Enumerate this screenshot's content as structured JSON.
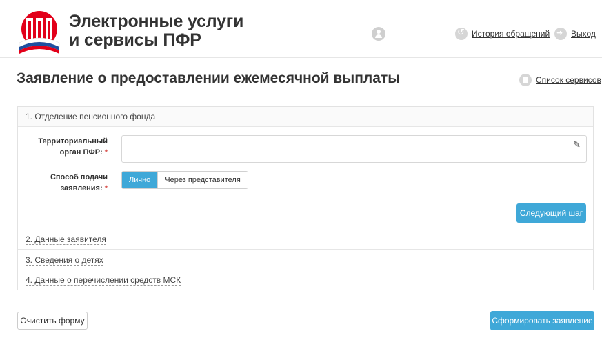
{
  "header": {
    "brand_line1": "Электронные услуги",
    "brand_line2": "и сервисы ПФР",
    "logo_icon": "pfr-logo-icon",
    "user_icon": "user-icon",
    "history_link": "История обращений",
    "history_icon": "history-icon",
    "exit_link": "Выход",
    "exit_icon": "exit-icon"
  },
  "page": {
    "title": "Заявление о предоставлении ежемесячной выплаты",
    "services_link": "Список сервисов",
    "services_icon": "list-icon"
  },
  "sections": [
    {
      "label": "1. Отделение пенсионного фонда"
    },
    {
      "label": "2. Данные заявителя"
    },
    {
      "label": "3. Сведения о детях"
    },
    {
      "label": "4. Данные о перечислении средств МСК"
    }
  ],
  "form": {
    "org_label_line1": "Территориальный",
    "org_label_line2": "орган ПФР:",
    "org_value": "",
    "method_label_line1": "Способ подачи",
    "method_label_line2": "заявления:",
    "method_options": [
      "Лично",
      "Через представителя"
    ],
    "method_selected": "Лично",
    "required_mark": "*",
    "next_button": "Следующий шаг"
  },
  "footer": {
    "clear_button": "Очистить форму",
    "submit_button": "Сформировать заявление"
  },
  "colors": {
    "accent": "#3fa8d8",
    "required": "#d9534f",
    "logo_red": "#e2001a",
    "flag_blue": "#1f4fa0"
  }
}
